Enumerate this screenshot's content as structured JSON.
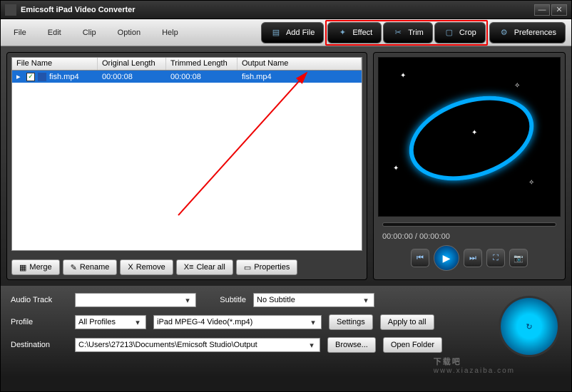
{
  "title": "Emicsoft iPad Video Converter",
  "menus": {
    "file": "File",
    "edit": "Edit",
    "clip": "Clip",
    "option": "Option",
    "help": "Help"
  },
  "toolbar": {
    "addfile": "Add File",
    "effect": "Effect",
    "trim": "Trim",
    "crop": "Crop",
    "prefs": "Preferences"
  },
  "table": {
    "headers": {
      "filename": "File Name",
      "origlen": "Original Length",
      "trimlen": "Trimmed Length",
      "outname": "Output Name"
    },
    "rows": [
      {
        "filename": "fish.mp4",
        "origlen": "00:00:08",
        "trimlen": "00:00:08",
        "outname": "fish.mp4",
        "checked": true
      }
    ]
  },
  "buttons": {
    "merge": "Merge",
    "rename": "Rename",
    "remove": "Remove",
    "clearall": "Clear all",
    "properties": "Properties"
  },
  "preview": {
    "timeLeft": "00:00:00 / 00:00:00"
  },
  "audio": {
    "label": "Audio Track",
    "value": ""
  },
  "subtitle": {
    "label": "Subtitle",
    "value": "No Subtitle"
  },
  "profile": {
    "label": "Profile",
    "group": "All Profiles",
    "value": "iPad MPEG-4 Video(*.mp4)",
    "settings": "Settings",
    "applyall": "Apply to all"
  },
  "dest": {
    "label": "Destination",
    "value": "C:\\Users\\27213\\Documents\\Emicsoft Studio\\Output",
    "browse": "Browse...",
    "open": "Open Folder"
  },
  "watermark": {
    "main": "下载吧",
    "url": "www.xiazaiba.com"
  }
}
